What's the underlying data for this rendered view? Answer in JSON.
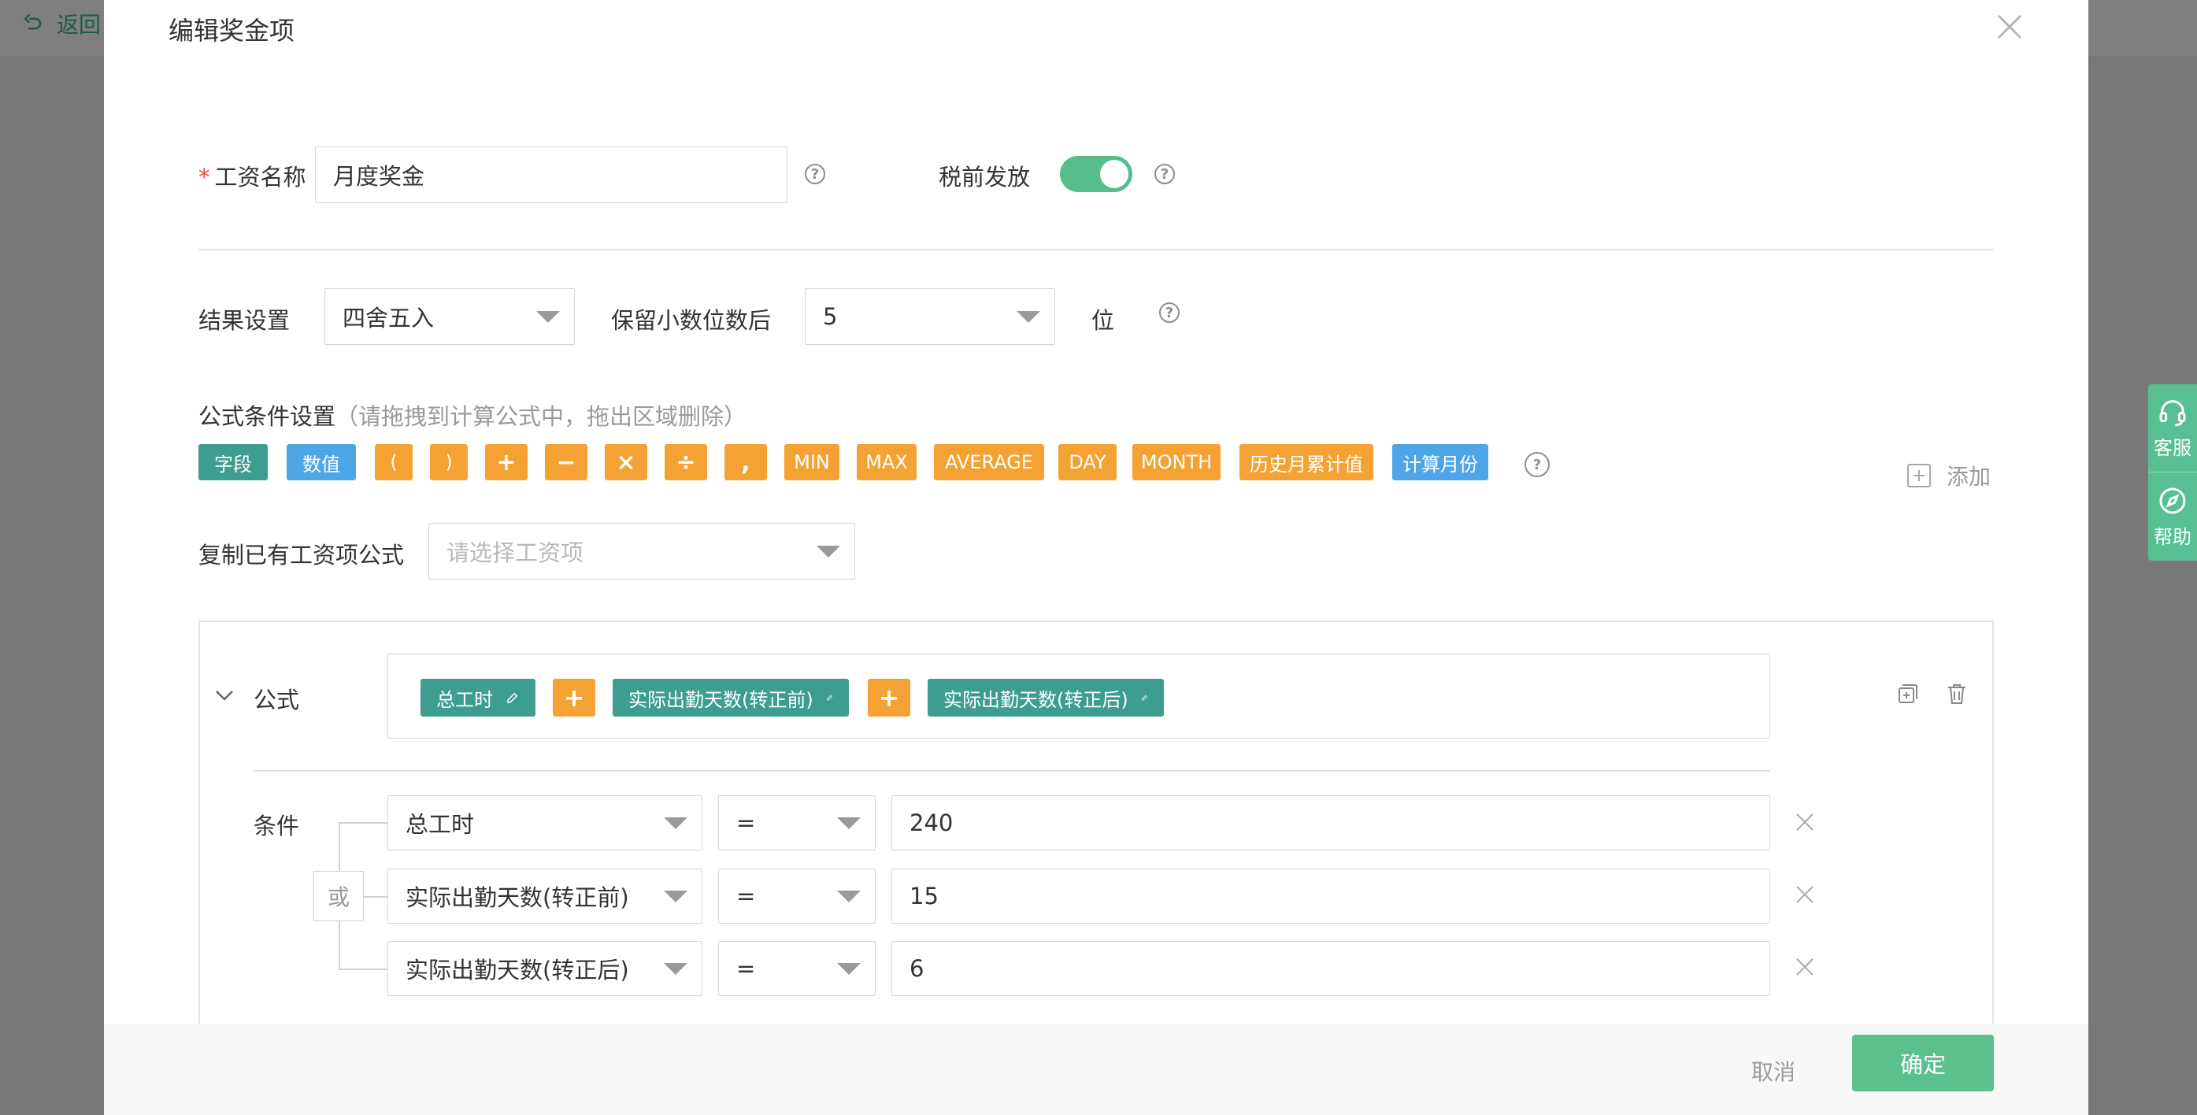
{
  "background": {
    "back_label": "返回"
  },
  "side_widget": {
    "service_label": "客服",
    "help_label": "帮助"
  },
  "modal": {
    "title": "编辑奖金项",
    "salary_name": {
      "label": "工资名称",
      "required_mark": "*",
      "value": "月度奖金"
    },
    "pretax": {
      "label": "税前发放",
      "enabled": true
    },
    "result": {
      "label": "结果设置",
      "value": "四舍五入",
      "decimals_label": "保留小数位数后",
      "decimals_value": "5",
      "unit": "位"
    },
    "formula_conditions": {
      "title": "公式条件设置",
      "hint": "（请拖拽到计算公式中，拖出区域删除）",
      "chips": [
        {
          "label": "字段",
          "color": "#3d9e8f"
        },
        {
          "label": "数值",
          "color": "#4ea6e6"
        },
        {
          "label": "(",
          "color": "#f3a233"
        },
        {
          "label": ")",
          "color": "#f3a233"
        },
        {
          "label": "+",
          "color": "#f3a233"
        },
        {
          "label": "−",
          "color": "#f3a233"
        },
        {
          "label": "×",
          "color": "#f3a233"
        },
        {
          "label": "÷",
          "color": "#f3a233"
        },
        {
          "label": ",",
          "color": "#f3a233"
        },
        {
          "label": "MIN",
          "color": "#f3a233"
        },
        {
          "label": "MAX",
          "color": "#f3a233"
        },
        {
          "label": "AVERAGE",
          "color": "#f3a233"
        },
        {
          "label": "DAY",
          "color": "#f3a233"
        },
        {
          "label": "MONTH",
          "color": "#f3a233"
        },
        {
          "label": "历史月累计值",
          "color": "#f3a233"
        },
        {
          "label": "计算月份",
          "color": "#4ea6e6"
        }
      ],
      "add_label": "添加"
    },
    "copy_formula": {
      "label": "复制已有工资项公式",
      "placeholder": "请选择工资项"
    },
    "formula": {
      "label": "公式",
      "tokens": [
        {
          "label": "总工时",
          "type": "field"
        },
        {
          "label": "+",
          "type": "operator"
        },
        {
          "label": "实际出勤天数(转正前)",
          "type": "field"
        },
        {
          "label": "+",
          "type": "operator"
        },
        {
          "label": "实际出勤天数(转正后)",
          "type": "field"
        }
      ]
    },
    "conditions": {
      "label": "条件",
      "logic": "或",
      "rows": [
        {
          "field": "总工时",
          "operator": "=",
          "value": "240"
        },
        {
          "field": "实际出勤天数(转正前)",
          "operator": "=",
          "value": "15"
        },
        {
          "field": "实际出勤天数(转正后)",
          "operator": "=",
          "value": "6"
        }
      ]
    },
    "footer": {
      "cancel_label": "取消",
      "ok_label": "确定"
    }
  }
}
